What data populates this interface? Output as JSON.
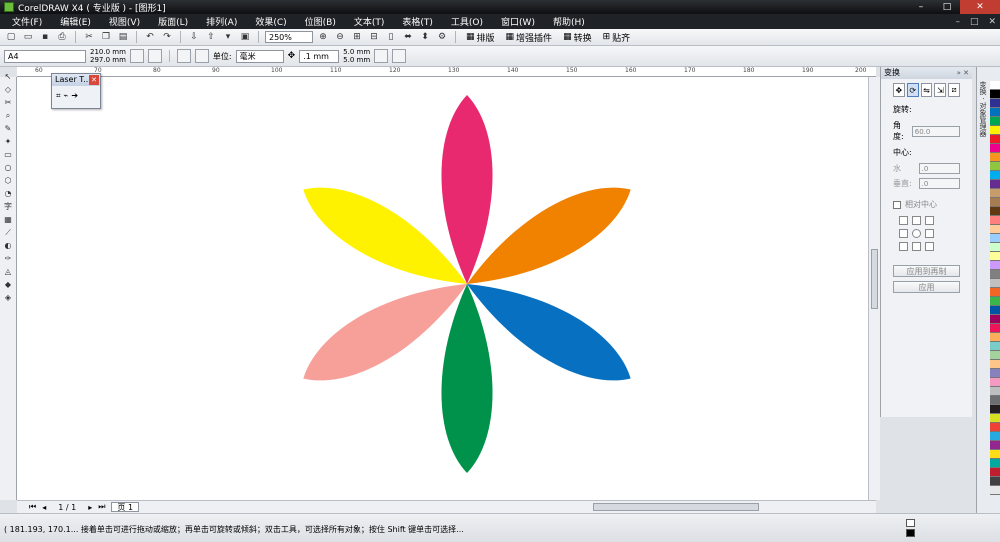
{
  "window": {
    "title": "CorelDRAW X4 ( 专业版 ) - [图形1]",
    "controls": [
      "–",
      "□",
      "✕"
    ]
  },
  "menu": {
    "items": [
      "文件(F)",
      "编辑(E)",
      "视图(V)",
      "版面(L)",
      "排列(A)",
      "效果(C)",
      "位图(B)",
      "文本(T)",
      "表格(T)",
      "工具(O)",
      "窗口(W)",
      "帮助(H)"
    ],
    "right_controls": [
      "–",
      "□",
      "✕"
    ]
  },
  "toolbar": {
    "zoom": "250%",
    "buttons": [
      "排版",
      "增强插件",
      "转换",
      "贴齐"
    ]
  },
  "property_bar": {
    "page_size": "A4",
    "width": "210.0 mm",
    "height": "297.0 mm",
    "unit_label": "单位:",
    "unit": "毫米",
    "nudge": ".1 mm",
    "dup_x": "5.0 mm",
    "dup_y": "5.0 mm"
  },
  "ruler": {
    "ticks": [
      "60",
      "70",
      "80",
      "90",
      "100",
      "110",
      "120",
      "130",
      "140",
      "150",
      "160",
      "170",
      "180",
      "190",
      "200"
    ]
  },
  "laser_panel": {
    "title": "Laser T..."
  },
  "docker": {
    "title": "变换",
    "rotate_label": "旋转:",
    "angle_label": "角度:",
    "angle_value": "60.0",
    "center_label": "中心:",
    "h_label": "水",
    "h_value": ".0",
    "v_label": "垂直:",
    "v_value": ".0",
    "relative_center": "相对中心",
    "apply_copy": "应用到再制",
    "apply": "应用"
  },
  "page_nav": {
    "count": "1 / 1",
    "tab": "页 1"
  },
  "status": {
    "text": "( 181.193, 170.1... 接着单击可进行拖动或缩放；再单击可旋转或倾斜；双击工具，可选择所有对象；按住 Shift 键单击可选择..."
  },
  "colors": {
    "petal_magenta": "#e8296f",
    "petal_orange": "#f08200",
    "petal_blue": "#0870c0",
    "petal_green": "#00924a",
    "petal_pink": "#f7a09a",
    "petal_yellow": "#fff200"
  },
  "palette": [
    "#ffffff",
    "#000000",
    "#2e3192",
    "#0072bc",
    "#00a651",
    "#fff200",
    "#ed1c24",
    "#ec008c",
    "#f7941d",
    "#8dc63f",
    "#00aeef",
    "#662d91",
    "#c69c6d",
    "#a67c52",
    "#603913",
    "#ff7f7f",
    "#ffcc99",
    "#99ccff",
    "#ccffcc",
    "#ffff99",
    "#cc99ff",
    "#808080",
    "#c0c0c0",
    "#f26522",
    "#39b54a",
    "#0054a6",
    "#9e005d",
    "#ed145b",
    "#fbaf5d",
    "#7accc8",
    "#a3d39c",
    "#fdc689",
    "#8781bd",
    "#f49ac2",
    "#bcbec0",
    "#6d6e71",
    "#231f20",
    "#d7df23",
    "#ef4136",
    "#27aae1",
    "#92278f",
    "#ffde17",
    "#00a99d",
    "#be1e2d",
    "#414042",
    "#e6e7e8"
  ]
}
